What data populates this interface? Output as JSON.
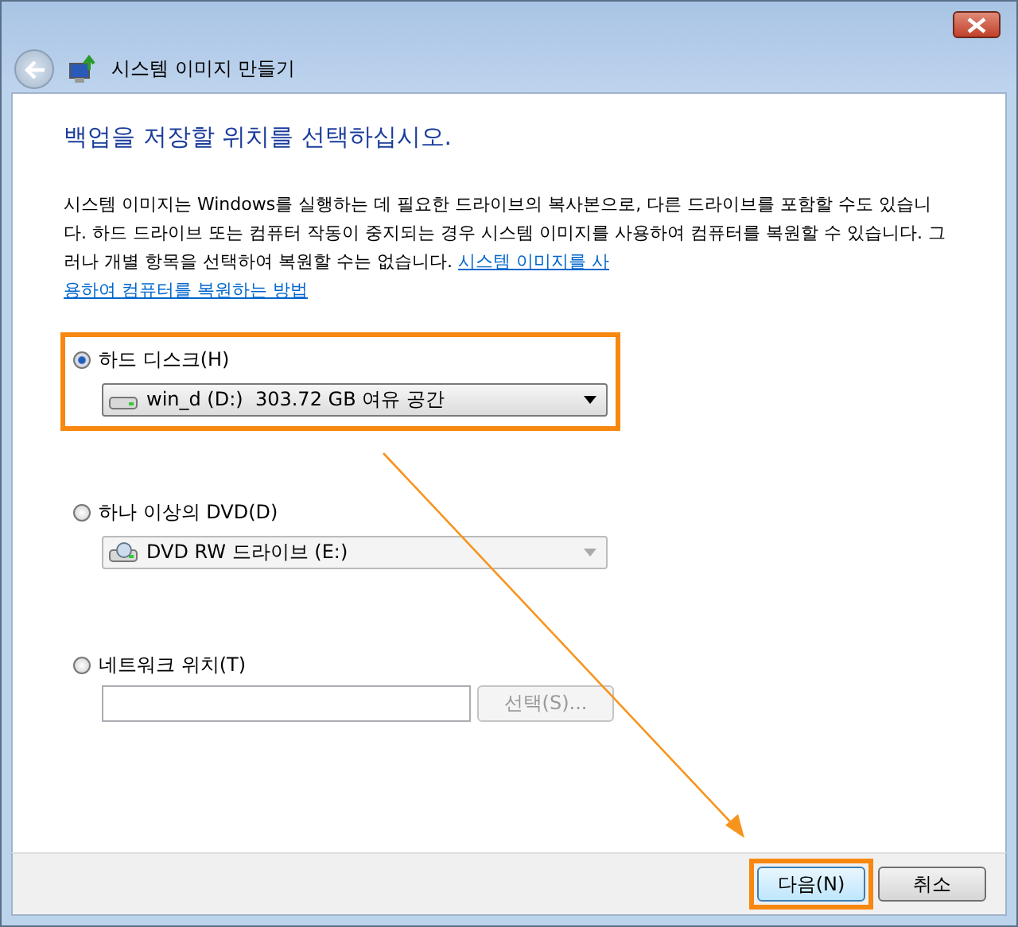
{
  "window": {
    "title": "시스템 이미지 만들기"
  },
  "heading": "백업을 저장할 위치를 선택하십시오.",
  "description": {
    "text": "시스템 이미지는 Windows를 실행하는 데 필요한 드라이브의 복사본으로, 다른 드라이브를 포함할 수도 있습니다. 하드 드라이브 또는 컴퓨터 작동이 중지되는 경우 시스템 이미지를 사용하여 컴퓨터를 복원할 수 있습니다. 그러나 개별 항목을 선택하여 복원할 수는 없습니다. ",
    "link": [
      "시스템 이미지를 사",
      "용하여 컴퓨터를 복원하는 방법"
    ]
  },
  "options": [
    {
      "label": "하드 디스크(H)",
      "selected": true,
      "kind": "dropdown",
      "value": "win_d (D:)  303.72 GB 여유 공간",
      "disabled": false,
      "highlighted": true
    },
    {
      "label": "하나 이상의 DVD(D)",
      "selected": false,
      "kind": "dropdown",
      "value": "DVD RW 드라이브 (E:)",
      "disabled": true,
      "highlighted": false
    },
    {
      "label": "네트워크 위치(T)",
      "selected": false,
      "kind": "path",
      "button": "선택(S)...",
      "disabled": true,
      "highlighted": false
    }
  ],
  "buttons": [
    {
      "label": "다음(N)",
      "highlighted": true
    },
    {
      "label": "취소",
      "highlighted": false
    }
  ]
}
